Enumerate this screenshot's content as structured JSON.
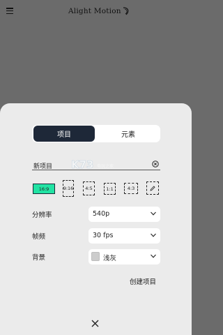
{
  "app": {
    "title": "Alight Motion",
    "menu_icon": "hamburger-menu-icon"
  },
  "colors": {
    "backdrop": "#6b6b6b",
    "sheet": "#ebebeb",
    "tab_active_bg": "#1e2838",
    "ratio_selected_bg": "#21e3a3"
  },
  "tabs": [
    {
      "label": "项目",
      "active": true
    },
    {
      "label": "元素",
      "active": false
    }
  ],
  "project_name": {
    "value": "新项目",
    "clear_icon": "clear-circle-icon"
  },
  "aspect_ratios": [
    {
      "label": "16:9",
      "selected": true
    },
    {
      "label": "9:16",
      "selected": false
    },
    {
      "label": "4:5",
      "selected": false
    },
    {
      "label": "1:1",
      "selected": false
    },
    {
      "label": "4:3",
      "selected": false
    },
    {
      "label": "",
      "icon": "pencil-icon",
      "selected": false
    }
  ],
  "settings": {
    "resolution": {
      "label": "分辨率",
      "value": "540p"
    },
    "frame_rate": {
      "label": "帧频",
      "value": "30 fps"
    },
    "background": {
      "label": "背景",
      "value": "浅灰",
      "swatch": "#cccccc"
    }
  },
  "create_label": "创建项目",
  "close_icon": "close-x-icon",
  "watermark": {
    "big": "K73",
    "small": "电玩之家"
  }
}
